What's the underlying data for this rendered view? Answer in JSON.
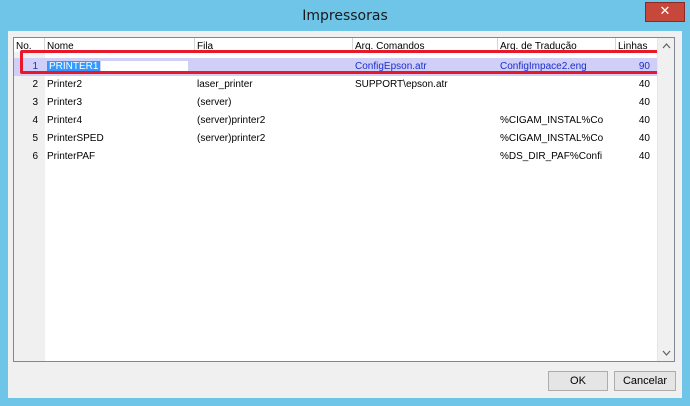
{
  "window": {
    "title": "Impressoras",
    "close_symbol": "✕"
  },
  "columns": [
    "No.",
    "Nome",
    "Fila",
    "Arq. Comandos",
    "Arq. de Tradução",
    "Linhas"
  ],
  "rows": [
    {
      "no": "1",
      "nome": "PRINTER1",
      "fila": "",
      "arq_comandos": "ConfigEpson.atr",
      "arq_traducao": "ConfigImpace2.eng",
      "linhas": "90"
    },
    {
      "no": "2",
      "nome": "Printer2",
      "fila": "laser_printer",
      "arq_comandos": "SUPPORT\\epson.atr",
      "arq_traducao": "",
      "linhas": "40"
    },
    {
      "no": "3",
      "nome": "Printer3",
      "fila": "(server)",
      "arq_comandos": "",
      "arq_traducao": "",
      "linhas": "40"
    },
    {
      "no": "4",
      "nome": "Printer4",
      "fila": "(server)printer2",
      "arq_comandos": "",
      "arq_traducao": "%CIGAM_INSTAL%Co",
      "linhas": "40"
    },
    {
      "no": "5",
      "nome": "PrinterSPED",
      "fila": "(server)printer2",
      "arq_comandos": "",
      "arq_traducao": "%CIGAM_INSTAL%Co",
      "linhas": "40"
    },
    {
      "no": "6",
      "nome": "PrinterPAF",
      "fila": "",
      "arq_comandos": "",
      "arq_traducao": "%DS_DIR_PAF%Confi",
      "linhas": "40"
    }
  ],
  "selected_row": 0,
  "buttons": {
    "ok": "OK",
    "cancel": "Cancelar"
  },
  "icons": {
    "scroll_up": "chevron-up-icon",
    "scroll_down": "chevron-down-icon",
    "close": "close-icon"
  },
  "colors": {
    "title_bar": "#6ec5e8",
    "selection_highlight": "#cfcff7",
    "annotation_box": "#e8182a",
    "close_button": "#c7473b"
  }
}
